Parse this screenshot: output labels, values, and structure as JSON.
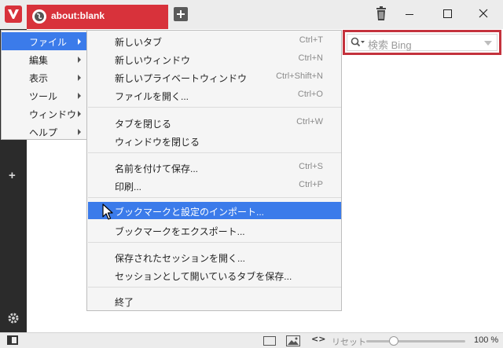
{
  "tab": {
    "title": "about:blank"
  },
  "search": {
    "placeholder": "検索 Bing"
  },
  "main_menu": {
    "items": [
      {
        "label": "ファイル",
        "active": true
      },
      {
        "label": "編集"
      },
      {
        "label": "表示"
      },
      {
        "label": "ツール"
      },
      {
        "label": "ウィンドウ"
      },
      {
        "label": "ヘルプ"
      }
    ]
  },
  "file_menu": {
    "items": [
      {
        "label": "新しいタブ",
        "shortcut": "Ctrl+T"
      },
      {
        "label": "新しいウィンドウ",
        "shortcut": "Ctrl+N"
      },
      {
        "label": "新しいプライベートウィンドウ",
        "shortcut": "Ctrl+Shift+N"
      },
      {
        "label": "ファイルを開く...",
        "shortcut": "Ctrl+O"
      },
      {
        "label": "タブを閉じる",
        "shortcut": "Ctrl+W"
      },
      {
        "label": "ウィンドウを閉じる",
        "shortcut": ""
      },
      {
        "label": "名前を付けて保存...",
        "shortcut": "Ctrl+S"
      },
      {
        "label": "印刷...",
        "shortcut": "Ctrl+P"
      },
      {
        "label": "ブックマークと設定のインポート...",
        "shortcut": "",
        "highlighted": true
      },
      {
        "label": "ブックマークをエクスポート...",
        "shortcut": ""
      },
      {
        "label": "保存されたセッションを開く...",
        "shortcut": ""
      },
      {
        "label": "セッションとして開いているタブを保存...",
        "shortcut": ""
      },
      {
        "label": "終了",
        "shortcut": ""
      }
    ]
  },
  "statusbar": {
    "reset_label": "リセット",
    "zoom_label": "100 %",
    "code_glyph": "<>"
  },
  "colors": {
    "accent_red": "#d8323b",
    "menu_highlight": "#3b7bea",
    "sidebar": "#2b2b2b"
  }
}
